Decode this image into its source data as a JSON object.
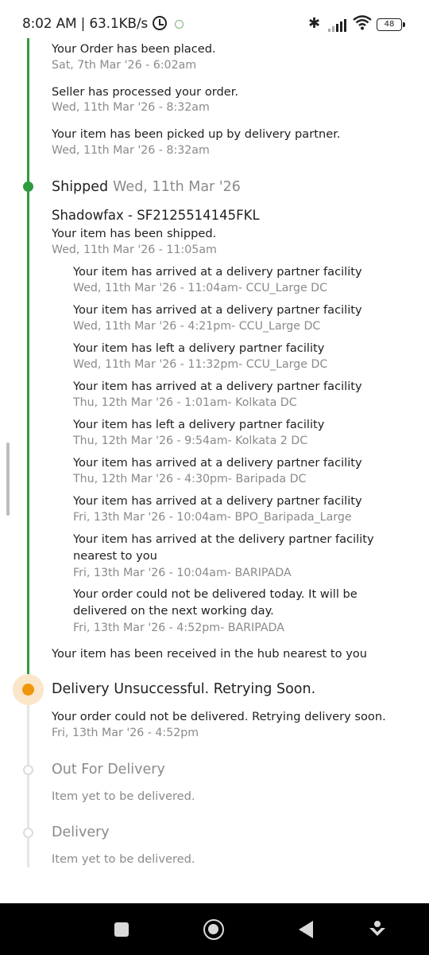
{
  "status_bar": {
    "time_speed": "8:02 AM | 63.1KB/s",
    "battery": "48"
  },
  "timeline_top": [
    {
      "event": "Your Order has been placed.",
      "date": "Sat, 7th Mar '26 - 6:02am"
    },
    {
      "event": "Seller has processed your order.",
      "date": "Wed, 11th Mar '26 - 8:32am"
    },
    {
      "event": "Your item has been picked up by delivery partner.",
      "date": "Wed, 11th Mar '26 - 8:32am"
    }
  ],
  "shipped": {
    "title": "Shipped",
    "date": "Wed, 11th Mar '26",
    "courier": "Shadowfax - SF2125514145FKL",
    "event": "Your item has been shipped.",
    "event_date": "Wed, 11th Mar '26 - 11:05am",
    "sub_events": [
      {
        "event": "Your item has arrived at a delivery partner facility",
        "date": "Wed, 11th Mar '26 - 11:04am- CCU_Large DC"
      },
      {
        "event": "Your item has arrived at a delivery partner facility",
        "date": "Wed, 11th Mar '26 - 4:21pm- CCU_Large DC"
      },
      {
        "event": "Your item has left a delivery partner facility",
        "date": "Wed, 11th Mar '26 - 11:32pm- CCU_Large DC"
      },
      {
        "event": "Your item has arrived at a delivery partner facility",
        "date": "Thu, 12th Mar '26 - 1:01am- Kolkata DC"
      },
      {
        "event": "Your item has left a delivery partner facility",
        "date": "Thu, 12th Mar '26 - 9:54am- Kolkata 2 DC"
      },
      {
        "event": "Your item has arrived at a delivery partner facility",
        "date": "Thu, 12th Mar '26 - 4:30pm- Baripada DC"
      },
      {
        "event": "Your item has arrived at a delivery partner facility",
        "date": "Fri, 13th Mar '26 - 10:04am- BPO_Baripada_Large"
      },
      {
        "event_line1": "Your item has arrived at the delivery partner facility",
        "event_line2": "nearest to you",
        "date": "Fri, 13th Mar '26 - 10:04am- BARIPADA"
      },
      {
        "event_line1": "Your order could not be delivered today. It will be",
        "event_line2": "delivered on the next working day.",
        "date": "Fri, 13th Mar '26 - 4:52pm- BARIPADA"
      }
    ],
    "hub_event": "Your item has been received in the hub nearest to you"
  },
  "delivery_unsuccessful": {
    "title": "Delivery Unsuccessful. Retrying Soon.",
    "event": "Your order could not be delivered. Retrying delivery soon.",
    "date": "Fri, 13th Mar '26 - 4:52pm"
  },
  "out_for_delivery": {
    "title": "Out For Delivery",
    "note": "Item yet to be delivered."
  },
  "delivery": {
    "title": "Delivery",
    "note": "Item yet to be delivered."
  },
  "colors": {
    "completed": "#2e9c3e",
    "current": "#f0960a",
    "pending": "#dcdcdc"
  }
}
